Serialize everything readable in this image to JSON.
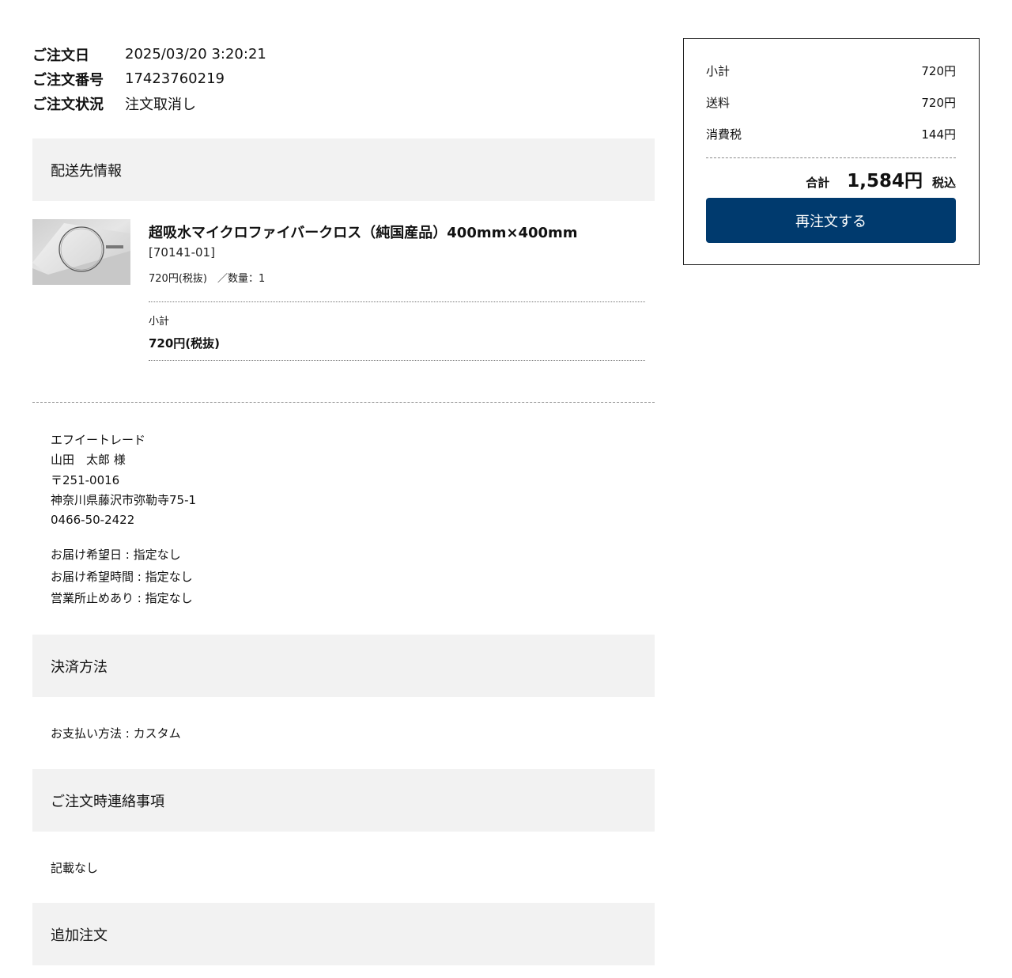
{
  "order_meta": {
    "date_label": "ご注文日",
    "date_value": "2025/03/20 3:20:21",
    "number_label": "ご注文番号",
    "number_value": "17423760219",
    "status_label": "ご注文状況",
    "status_value": "注文取消し"
  },
  "shipping": {
    "header": "配送先情報",
    "product": {
      "name": "超吸水マイクロファイバークロス（純国産品）400mm×400mm",
      "code": "[70141-01]",
      "price_qty": "720円(税抜)　／数量：1",
      "subtotal_label": "小計",
      "subtotal_value": "720円(税抜)"
    },
    "address": {
      "company": "エフイートレード",
      "name": "山田　太郎 様",
      "zip": "〒251-0016",
      "address": "神奈川県藤沢市弥勒寺75-1",
      "phone": "0466-50-2422"
    },
    "delivery_date": "お届け希望日 : 指定なし",
    "delivery_time": "お届け希望時間 : 指定なし",
    "business_holiday": "営業所止めあり : 指定なし"
  },
  "payment": {
    "header": "決済方法",
    "method": "お支払い方法 : カスタム"
  },
  "notes": {
    "header": "ご注文時連絡事項",
    "text": "記載なし"
  },
  "additional": {
    "header": "追加注文"
  },
  "summary": {
    "subtotal_label": "小計",
    "subtotal_value": "720円",
    "shipping_label": "送料",
    "shipping_value": "720円",
    "tax_label": "消費税",
    "tax_value": "144円",
    "total_label": "合計",
    "total_value": "1,584円",
    "total_tax_note": "税込",
    "reorder_label": "再注文する"
  },
  "colors": {
    "button_bg": "#003a6e",
    "section_bg": "#f2f2f2"
  }
}
